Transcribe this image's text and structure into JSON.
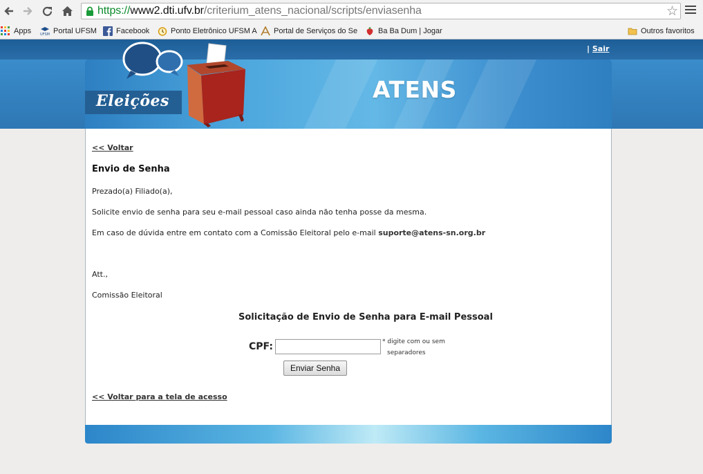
{
  "browser": {
    "url": {
      "protocol": "https://",
      "host": "www2.dti.ufv.br",
      "path": "/criterium_atens_nacional/scripts/enviasenha"
    },
    "bookmarks": [
      {
        "label": "Apps",
        "icon": "apps-grid-icon"
      },
      {
        "label": "Portal UFSM",
        "icon": "ufsm-icon"
      },
      {
        "label": "Facebook",
        "icon": "facebook-icon"
      },
      {
        "label": "Ponto Eletrônico UFSM A",
        "icon": "clock-icon"
      },
      {
        "label": "Portal de Serviços do Se",
        "icon": "portal-icon"
      },
      {
        "label": "Ba Ba Dum | Jogar",
        "icon": "strawberry-icon"
      },
      {
        "label": "Outros favoritos",
        "icon": "folder-icon"
      }
    ]
  },
  "header": {
    "separator": "|",
    "sair": "Sair",
    "banner_left": "Eleições",
    "banner_title": "ATENS"
  },
  "content": {
    "back_link": "<< Voltar",
    "heading": "Envio de Senha",
    "greeting": "Prezado(a) Filiado(a),",
    "paragraph1": "Solicite envio de senha para seu e-mail pessoal caso ainda não tenha posse da mesma.",
    "paragraph2_prefix": "Em caso de dúvida entre em contato com a Comissão Eleitoral pelo e-mail",
    "support_email": "suporte@atens-sn.org.br",
    "att": "Att.,",
    "signature": "Comissão Eleitoral",
    "form": {
      "title": "Solicitação de Envio de Senha para E-mail Pessoal",
      "cpf_label": "CPF:",
      "cpf_value": "",
      "hint_line1": "* digite com ou sem",
      "hint_line2": "separadores",
      "submit_label": "Enviar Senha"
    },
    "back_to_login": "<< Voltar para a tela de acesso"
  },
  "colors": {
    "header_dark": "#1d5e97",
    "header_blue": "#3a8ccb",
    "url_protocol": "#0b8a2a"
  }
}
